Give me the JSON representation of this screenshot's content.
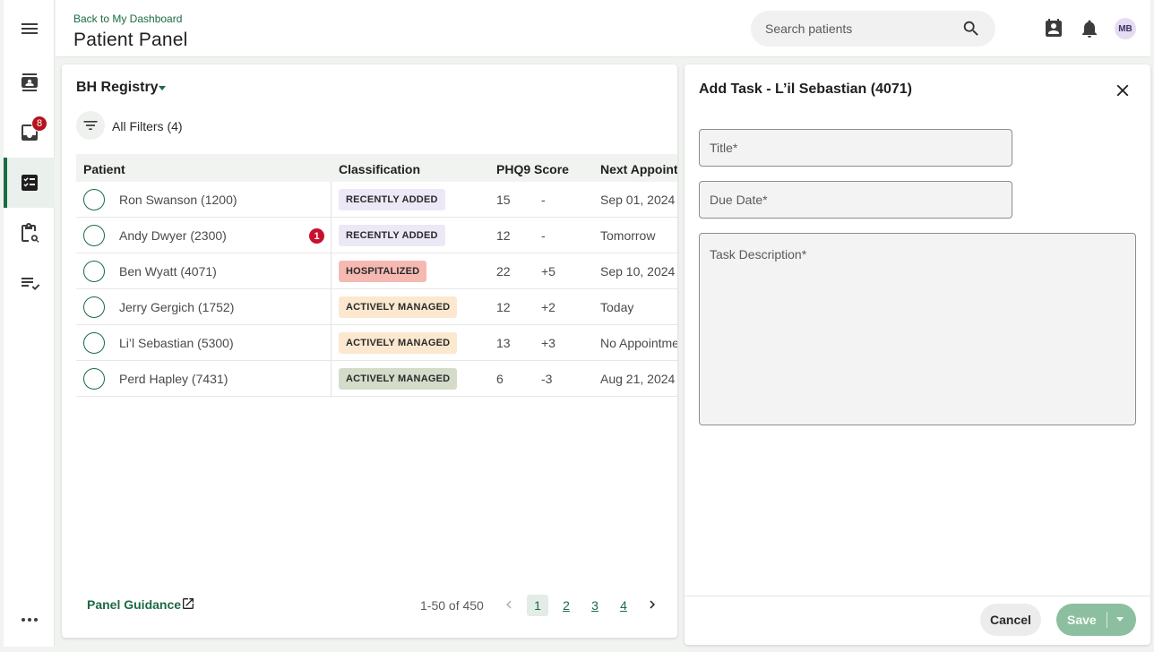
{
  "header": {
    "back_link": "Back to My Dashboard",
    "title": "Patient Panel",
    "search_placeholder": "Search patients",
    "avatar_initials": "MB"
  },
  "rail": {
    "inbox_badge": "8",
    "items": [
      "menu-icon",
      "contacts-icon",
      "inbox-icon",
      "task-list-icon",
      "clipboard-search-icon",
      "checklist-icon",
      "more-icon"
    ]
  },
  "registry": {
    "name": "BH Registry",
    "filters_label": "All Filters (4)"
  },
  "table": {
    "columns": [
      "Patient",
      "Classification",
      "PHQ9 Score",
      "Next Appointr"
    ],
    "rows": [
      {
        "patient": "Ron Swanson (1200)",
        "classification": "RECENTLY ADDED",
        "score": "15",
        "delta": "-",
        "next": "Sep 01, 2024",
        "notif": ""
      },
      {
        "patient": "Andy Dwyer (2300)",
        "classification": "RECENTLY ADDED",
        "score": "12",
        "delta": "-",
        "next": "Tomorrow",
        "notif": "1"
      },
      {
        "patient": "Ben Wyatt (4071)",
        "classification": "HOSPITALIZED",
        "score": "22",
        "delta": "+5",
        "next": "Sep 10, 2024",
        "notif": ""
      },
      {
        "patient": "Jerry Gergich (1752)",
        "classification": "ACTIVELY MANAGED",
        "score": "12",
        "delta": "+2",
        "next": "Today",
        "notif": ""
      },
      {
        "patient": "Li’l Sebastian (5300)",
        "classification": "ACTIVELY MANAGED",
        "score": "13",
        "delta": "+3",
        "next": "No Appointme",
        "notif": ""
      },
      {
        "patient": "Perd Hapley (7431)",
        "classification": "ACTIVELY MANAGED",
        "score": "6",
        "delta": "-3",
        "next": "Aug 21, 2024",
        "notif": ""
      }
    ]
  },
  "tag_colors": {
    "recently_added": "#ece8f6",
    "hospitalized": "#f6b9b2",
    "actively_managed": "#fbe8cf",
    "actively_managed_alt": "#d4dcc9"
  },
  "card_footer": {
    "guidance": "Panel Guidance",
    "range": "1-50 of 450",
    "pages": [
      "1",
      "2",
      "3",
      "4"
    ],
    "current_page": "1"
  },
  "panel": {
    "title": "Add Task - L’il Sebastian (4071)",
    "title_placeholder": "Title*",
    "due_placeholder": "Due Date*",
    "description_placeholder": "Task Description*",
    "cancel": "Cancel",
    "save": "Save"
  },
  "colors": {
    "brand_green": "#1b6b43",
    "alert_red": "#c8102e",
    "save_disabled": "#8cbf9f"
  }
}
